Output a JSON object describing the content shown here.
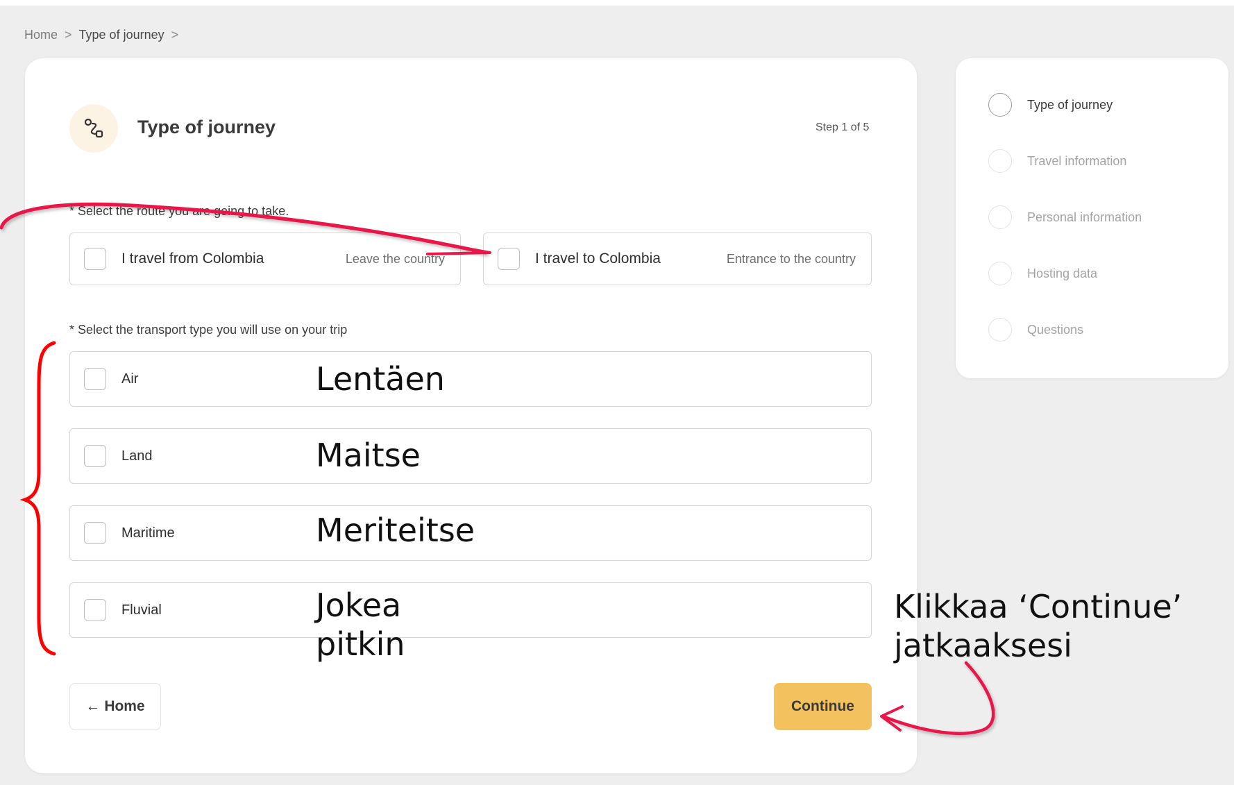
{
  "breadcrumb": {
    "home": "Home",
    "current": "Type of journey",
    "separator": ">"
  },
  "card": {
    "icon": "route-icon",
    "title": "Type of journey",
    "step_label": "Step 1 of 5"
  },
  "route_question": "* Select the route you are going to take.",
  "route_options": [
    {
      "title": "I travel from Colombia",
      "subtitle": "Leave the country"
    },
    {
      "title": "I travel to Colombia",
      "subtitle": "Entrance to the country"
    }
  ],
  "transport_question": "* Select the transport type you will use on your trip",
  "transport_options": [
    {
      "label": "Air",
      "annotation": "Lentäen"
    },
    {
      "label": "Land",
      "annotation": "Maitse"
    },
    {
      "label": "Maritime",
      "annotation": "Meriteitse"
    },
    {
      "label": "Fluvial",
      "annotation_line1": "Jokea",
      "annotation_line2": "pitkin"
    }
  ],
  "buttons": {
    "home_arrow": "←",
    "home_label": "Home",
    "continue_label": "Continue"
  },
  "continue_annotation": {
    "line1": "Klikkaa ‘Continue’",
    "line2": "jatkaaksesi"
  },
  "steps": [
    {
      "label": "Type of journey",
      "active": true
    },
    {
      "label": "Travel information",
      "active": false
    },
    {
      "label": "Personal information",
      "active": false
    },
    {
      "label": "Hosting data",
      "active": false
    },
    {
      "label": "Questions",
      "active": false
    }
  ],
  "colors": {
    "accent_button": "#f4c15f",
    "annotation_red": "#e8194a",
    "background": "#eeeeee"
  }
}
